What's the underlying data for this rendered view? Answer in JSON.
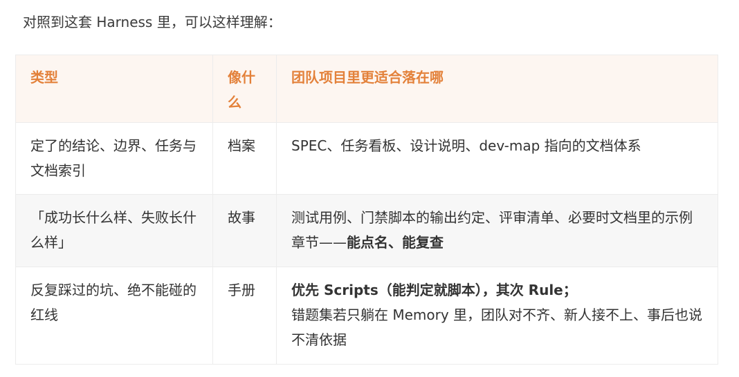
{
  "intro_text": "对照到这套 Harness 里，可以这样理解：",
  "table": {
    "headers": {
      "type": "类型",
      "analogy": "像什么",
      "location": "团队项目里更适合落在哪"
    },
    "rows": [
      {
        "type": "定了的结论、边界、任务与文档索引",
        "analogy": "档案",
        "location": "SPEC、任务看板、设计说明、dev-map 指向的文档体系"
      },
      {
        "type": "「成功长什么样、失败长什么样」",
        "analogy": "故事",
        "location_prefix": "测试用例、门禁脚本的输出约定、评审清单、必要时文档里的示例章节——",
        "location_bold": "能点名、能复查"
      },
      {
        "type": "反复踩过的坑、绝不能碰的红线",
        "analogy": "手册",
        "location_bold": "优先 Scripts（能判定就脚本），其次 Rule；",
        "location_rest": "错题集若只躺在 Memory 里，团队对不齐、新人接不上、事后也说不清依据"
      }
    ]
  },
  "colors": {
    "header_bg": "#fdf6f1",
    "header_text": "#e3813a",
    "striped_row_bg": "#f7f7f7",
    "border": "#ececec"
  }
}
